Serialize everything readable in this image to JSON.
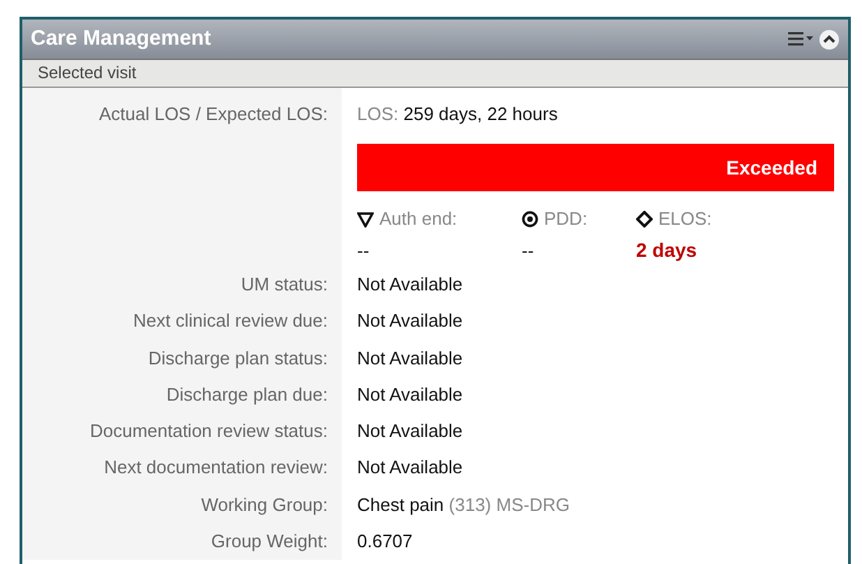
{
  "panel": {
    "title": "Care Management",
    "subtitle": "Selected visit"
  },
  "los": {
    "label": "Actual LOS / Expected LOS:",
    "prefix": "LOS:",
    "value": "259 days, 22 hours",
    "status": {
      "text": "Exceeded",
      "kind": "exceeded"
    }
  },
  "milestones": [
    {
      "kind": "auth",
      "label": "Auth end:",
      "value": "--",
      "highlighted": false
    },
    {
      "kind": "pdd",
      "label": "PDD:",
      "value": "--",
      "highlighted": false
    },
    {
      "kind": "elos",
      "label": "ELOS:",
      "value": "2 days",
      "highlighted": true
    }
  ],
  "fields": [
    {
      "label": "UM status:",
      "value": "Not Available"
    },
    {
      "label": "Next clinical review due:",
      "value": "Not Available"
    },
    {
      "label": "Discharge plan status:",
      "value": "Not Available"
    },
    {
      "label": "Discharge plan due:",
      "value": "Not Available"
    },
    {
      "label": "Documentation review status:",
      "value": "Not Available"
    },
    {
      "label": "Next documentation review:",
      "value": "Not Available"
    },
    {
      "label": "Working Group:",
      "value": "Chest pain",
      "code": "(313)",
      "scheme": "MS-DRG"
    },
    {
      "label": "Group Weight:",
      "value": "0.6707"
    }
  ]
}
